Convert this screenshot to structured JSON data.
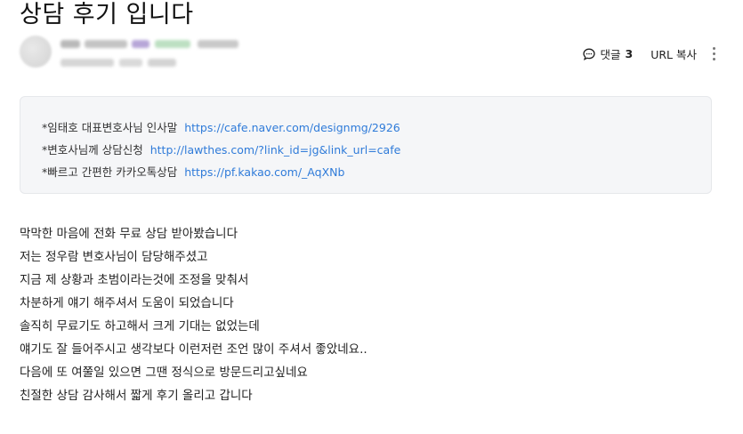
{
  "post": {
    "title": "상담 후기 입니다"
  },
  "actions": {
    "comment_label": "댓글",
    "comment_count": "3",
    "url_copy_label": "URL 복사"
  },
  "notice": [
    {
      "label": "*임태호 대표변호사님 인사말",
      "link": "https://cafe.naver.com/designmg/2926"
    },
    {
      "label": "*변호사님께 상담신청",
      "link": "http://lawthes.com/?link_id=jg&link_url=cafe"
    },
    {
      "label": "*빠르고 간편한 카카오톡상담",
      "link": "https://pf.kakao.com/_AqXNb"
    }
  ],
  "body_lines": [
    "막막한 마음에 전화 무료 상담 받아봤습니다",
    "저는 정우람 변호사님이 담당해주셨고",
    "지금 제 상황과 초범이라는것에 조정을 맞춰서",
    "차분하게 얘기 해주셔서 도움이 되었습니다",
    "솔직히 무료기도 하고해서 크게 기대는 없었는데",
    "얘기도 잘 들어주시고 생각보다 이런저런 조언 많이 주셔서 좋았네요..",
    "다음에 또 여쭐일 있으면 그땐 정식으로 방문드리고싶네요",
    "친절한 상담 감사해서 짧게 후기 올리고 갑니다"
  ]
}
